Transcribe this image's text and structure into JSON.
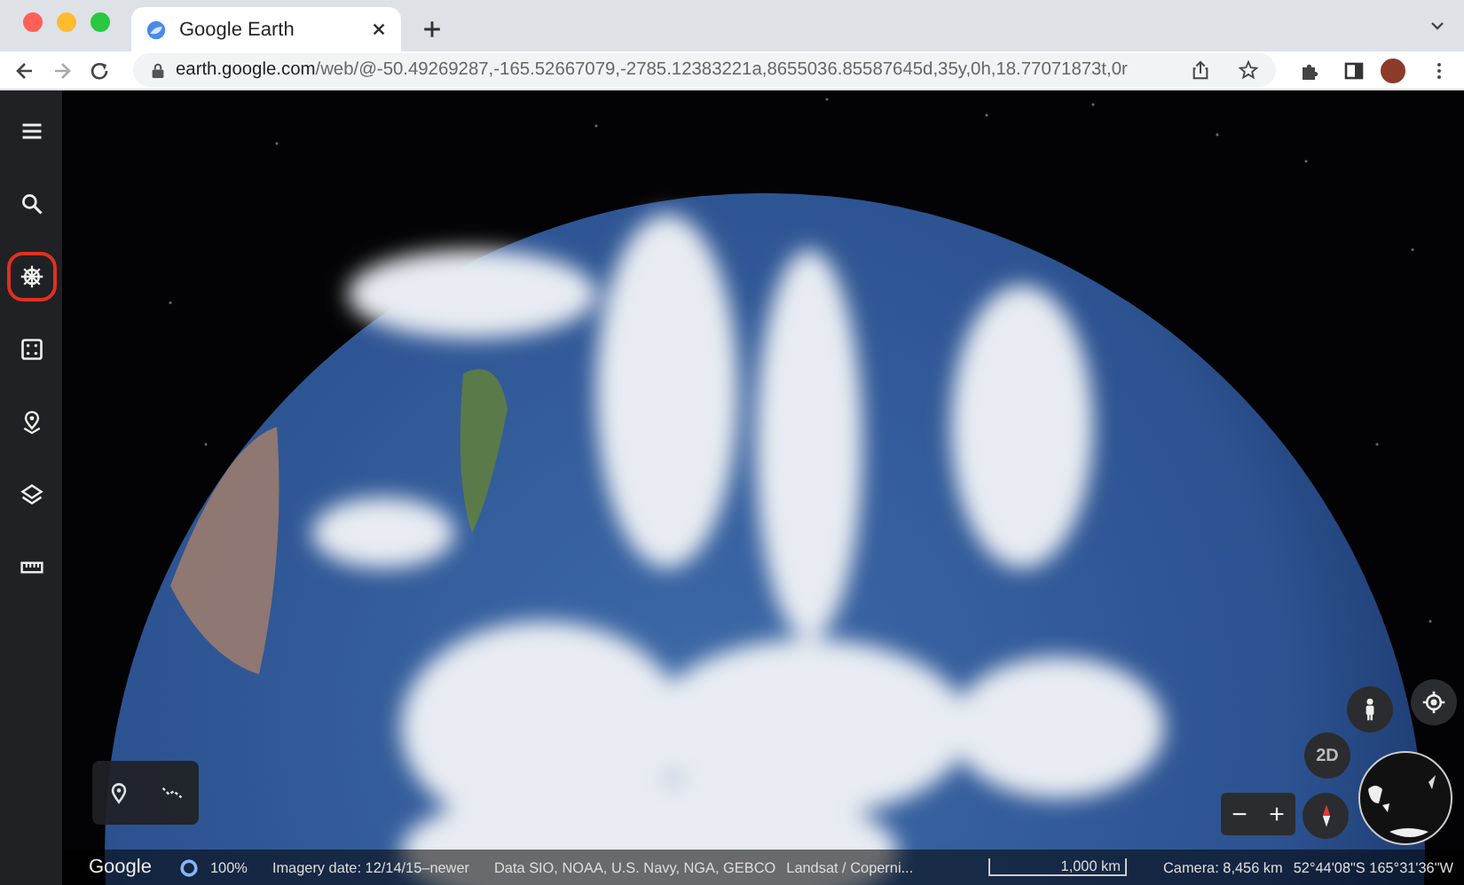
{
  "browser": {
    "tab": {
      "title": "Google Earth",
      "selected": true
    },
    "url": {
      "domain": "earth.google.com",
      "path": "/web/@-50.49269287,-165.52667079,-2785.12383221a,8655036.85587645d,35y,0h,18.77071873t,0r"
    }
  },
  "sidebar": {
    "items": [
      {
        "kind": "menu",
        "selected": false
      },
      {
        "kind": "search",
        "selected": false
      },
      {
        "kind": "voyager",
        "selected": true
      },
      {
        "kind": "dice",
        "selected": false
      },
      {
        "kind": "pin",
        "selected": false
      },
      {
        "kind": "layers",
        "selected": false
      },
      {
        "kind": "ruler",
        "selected": false
      }
    ]
  },
  "map_controls": {
    "view_toggle": "2D",
    "zoom_out": "−",
    "zoom_in": "+"
  },
  "status_bar": {
    "logo": "Google",
    "loading": "100%",
    "imagery_date": "Imagery date: 12/14/15–newer",
    "data": "Data SIO, NOAA, U.S. Navy, NGA, GEBCO",
    "data_2": "Landsat / Coperni...",
    "scale": "1,000 km",
    "camera": "Camera: 8,456 km",
    "coordinates": "52°44'08\"S 165°31'36\"W"
  }
}
